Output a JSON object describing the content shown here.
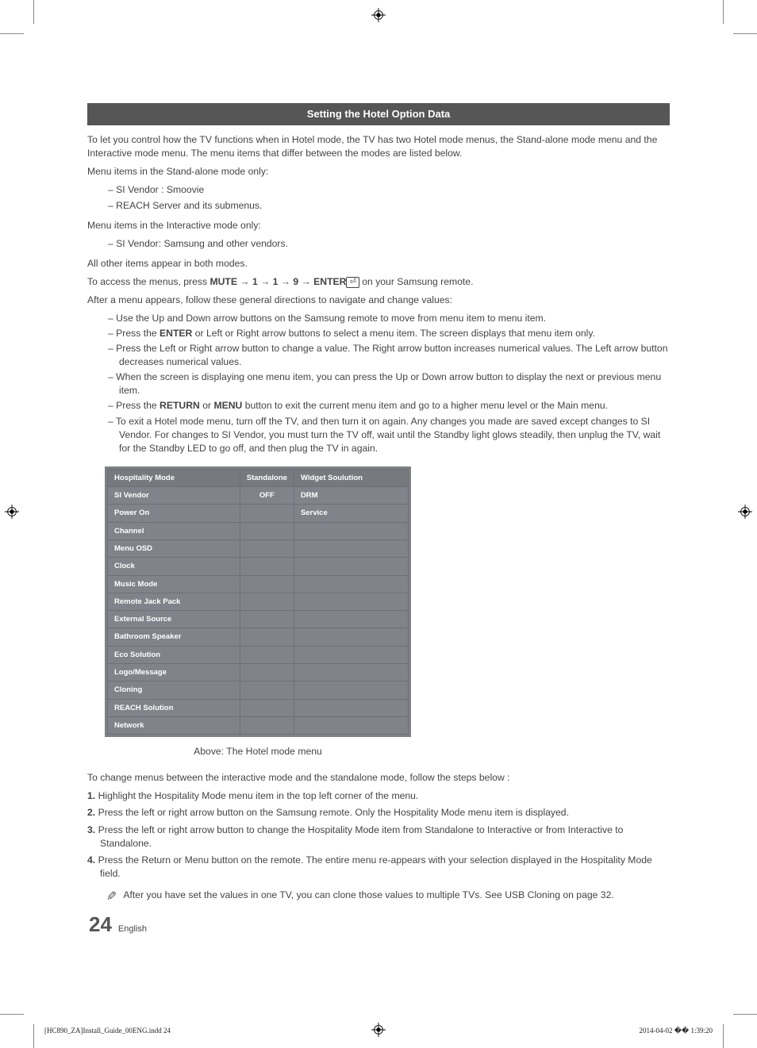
{
  "header": {
    "title": "Setting the Hotel Option Data"
  },
  "intro": "To let you control how the TV functions when in Hotel mode, the TV has two Hotel mode menus, the Stand-alone mode menu and the Interactive mode menu. The menu items that differ between the modes are listed below.",
  "standalone_heading": "Menu items in the Stand-alone mode only:",
  "standalone_items": [
    "SI Vendor : Smoovie",
    "REACH Server and its submenus."
  ],
  "interactive_heading": "Menu items in the Interactive mode only:",
  "interactive_items": [
    "SI Vendor: Samsung and other vendors."
  ],
  "both_modes": "All other items appear in both modes.",
  "access": {
    "prefix": "To access the menus, press ",
    "sequence": "MUTE → 1 → 1 → 9 → ENTER",
    "suffix": " on your Samsung remote."
  },
  "directions_heading": "After a menu appears, follow these general directions to navigate and change values:",
  "directions": [
    "Use the Up and Down arrow buttons on the Samsung remote to move from menu item to menu item.",
    "Press the <b>ENTER</b> or Left or Right arrow buttons to select a menu item. The screen displays that menu item only.",
    "Press the Left or Right arrow button to change a value. The Right arrow button increases numerical values. The Left arrow button decreases numerical values.",
    "When the screen is displaying one menu item, you can press the Up or Down arrow button to display the next or previous menu item.",
    "Press the <b>RETURN</b> or <b>MENU</b> button to exit the current menu item and go to a higher menu level or the Main menu.",
    "To exit a Hotel mode menu, turn off the TV, and then turn it on again. Any changes you made are saved except changes to SI Vendor. For changes to SI Vendor, you must turn the TV off, wait until the Standby light glows steadily, then unplug the TV, wait for the Standby LED to go off, and then plug the TV in again."
  ],
  "menu": {
    "rows": [
      {
        "left": "Hospitality Mode",
        "lval": "Standalone",
        "right": "Widget Soulution"
      },
      {
        "left": "SI Vendor",
        "lval": "OFF",
        "right": "DRM"
      },
      {
        "left": "Power On",
        "lval": "",
        "right": "Service"
      },
      {
        "left": "Channel",
        "lval": "",
        "right": ""
      },
      {
        "left": "Menu OSD",
        "lval": "",
        "right": ""
      },
      {
        "left": "Clock",
        "lval": "",
        "right": ""
      },
      {
        "left": "Music Mode",
        "lval": "",
        "right": ""
      },
      {
        "left": "Remote Jack Pack",
        "lval": "",
        "right": ""
      },
      {
        "left": "External Source",
        "lval": "",
        "right": ""
      },
      {
        "left": "Bathroom Speaker",
        "lval": "",
        "right": ""
      },
      {
        "left": "Eco Solution",
        "lval": "",
        "right": ""
      },
      {
        "left": "Logo/Message",
        "lval": "",
        "right": ""
      },
      {
        "left": "Cloning",
        "lval": "",
        "right": ""
      },
      {
        "left": "REACH Solution",
        "lval": "",
        "right": ""
      },
      {
        "left": "Network",
        "lval": "",
        "right": ""
      }
    ],
    "caption": "Above: The Hotel mode menu"
  },
  "change_intro": "To change menus between the interactive mode and the standalone mode, follow the steps below :",
  "steps": [
    {
      "n": "1.",
      "t": "Highlight the Hospitality Mode menu item in the top left corner of the menu."
    },
    {
      "n": "2.",
      "t": "Press the left or right arrow button on the Samsung remote. Only the Hospitality Mode menu item is displayed."
    },
    {
      "n": "3.",
      "t": "Press the left or right arrow button to change the Hospitality Mode item from Standalone to Interactive or from Interactive to Standalone."
    },
    {
      "n": "4.",
      "t": "Press the Return or Menu button on the remote. The entire menu re-appears with your selection displayed in the Hospitality Mode field."
    }
  ],
  "note": "After you have set the values in one TV, you can clone those values to multiple TVs. See USB Cloning on page 32.",
  "page": {
    "number": "24",
    "lang": "English"
  },
  "footer": {
    "file": "[HC890_ZA]Install_Guide_00ENG.indd   24",
    "timestamp": "2014-04-02   �� 1:39:20"
  }
}
